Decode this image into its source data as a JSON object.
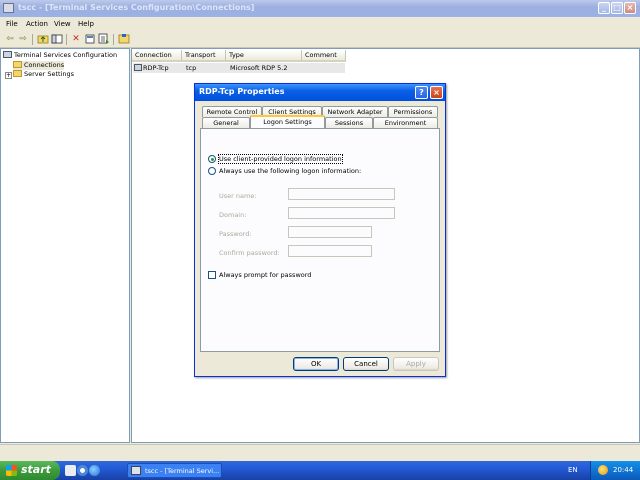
{
  "window": {
    "title": "tscc - [Terminal Services Configuration\\Connections]",
    "min_glyph": "_",
    "max_glyph": "□",
    "close_glyph": "×"
  },
  "menu": [
    "File",
    "Action",
    "View",
    "Help"
  ],
  "toolbar": {
    "icons": [
      "back-arrow-icon",
      "forward-arrow-icon",
      "up-folder-icon",
      "show-hide-tree-icon",
      "delete-icon",
      "properties-icon",
      "export-list-icon",
      "help-icon"
    ],
    "back_glyph": "⇦",
    "forward_glyph": "⇨",
    "delete_glyph": "✕"
  },
  "tree": {
    "root": "Terminal Services Configuration",
    "items": [
      {
        "label": "Connections",
        "selected": true
      },
      {
        "label": "Server Settings",
        "selected": false
      }
    ],
    "expand_glyph": "+"
  },
  "list": {
    "columns": [
      "Connection",
      "Transport",
      "Type",
      "Comment"
    ],
    "rows": [
      {
        "connection": "RDP-Tcp",
        "transport": "tcp",
        "type": "Microsoft RDP 5.2",
        "comment": ""
      }
    ]
  },
  "dialog": {
    "title": "RDP-Tcp Properties",
    "help_glyph": "?",
    "close_glyph": "×",
    "tabs_top": [
      "Remote Control",
      "Client Settings",
      "Network Adapter",
      "Permissions"
    ],
    "tabs_bottom": [
      "General",
      "Logon Settings",
      "Sessions",
      "Environment"
    ],
    "active_tab": "Logon Settings",
    "radio_client": "Use client-provided logon information",
    "radio_following": "Always use the following logon information:",
    "selected_radio": "client",
    "fields": {
      "user_name": {
        "label": "User name:",
        "value": ""
      },
      "domain": {
        "label": "Domain:",
        "value": ""
      },
      "password": {
        "label": "Password:",
        "value": ""
      },
      "confirm_password": {
        "label": "Confirm password:",
        "value": ""
      }
    },
    "always_prompt": {
      "label": "Always prompt for password",
      "checked": false
    },
    "buttons": {
      "ok": "OK",
      "cancel": "Cancel",
      "apply": "Apply"
    }
  },
  "taskbar": {
    "start": "start",
    "task": "tscc - [Terminal Servi...",
    "language": "EN",
    "clock": "20:44"
  },
  "colors": {
    "dialog_title": "#0050e0",
    "inactive_title": "#9db0e0",
    "active_tab_accent": "#ffc83c",
    "taskbar": "#245edb",
    "start_button": "#3c9a3c"
  }
}
